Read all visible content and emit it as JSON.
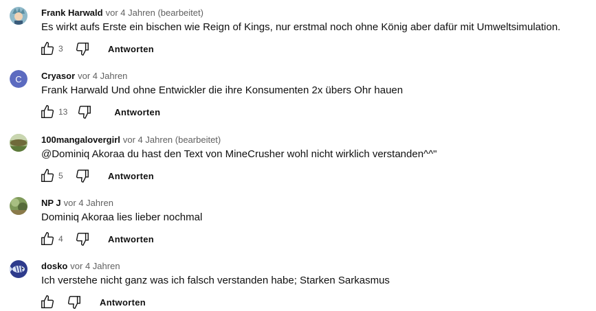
{
  "comments": [
    {
      "author": "Frank Harwald",
      "meta": "vor 4 Jahren (bearbeitet)",
      "text": "Es wirkt aufs Erste ein bischen wie Reign of Kings, nur erstmal noch ohne König aber dafür mit Umweltsimulation.",
      "likes": "3",
      "reply_label": "Antworten",
      "avatar": {
        "type": "image",
        "icon": "anime-character-avatar"
      }
    },
    {
      "author": "Cryasor",
      "meta": "vor 4 Jahren",
      "text": "Frank Harwald Und ohne Entwickler die ihre Konsumenten 2x übers Ohr hauen",
      "likes": "13",
      "reply_label": "Antworten",
      "avatar": {
        "type": "letter",
        "letter": "C",
        "color": "#5c6bc0"
      }
    },
    {
      "author": "100mangalovergirl",
      "meta": "vor 4 Jahren (bearbeitet)",
      "text": "@Dominiq Akoraa du hast den Text von MineCrusher wohl nicht wirklich verstanden^^\"",
      "likes": "5",
      "reply_label": "Antworten",
      "avatar": {
        "type": "image",
        "icon": "landscape-avatar"
      }
    },
    {
      "author": "NP J",
      "meta": "vor 4 Jahren",
      "text": "Dominiq Akoraa lies lieber nochmal",
      "likes": "4",
      "reply_label": "Antworten",
      "avatar": {
        "type": "image",
        "icon": "nature-avatar"
      }
    },
    {
      "author": "dosko",
      "meta": "vor 4 Jahren",
      "text": "Ich verstehe nicht ganz was ich falsch verstanden habe; Starken Sarkasmus",
      "likes": "",
      "reply_label": "Antworten",
      "avatar": {
        "type": "image",
        "icon": "fish-avatar"
      }
    }
  ]
}
